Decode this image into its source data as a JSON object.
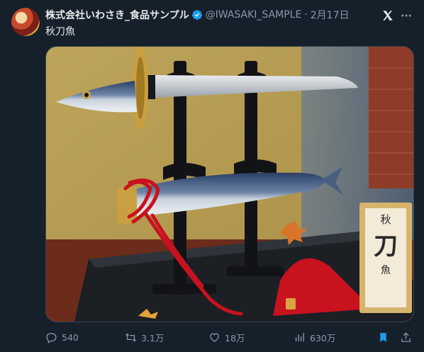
{
  "post": {
    "display_name": "株式会社いわさき_食品サンプル",
    "handle": "@IWASAKI_SAMPLE",
    "separator": "·",
    "date": "2月17日",
    "text": "秋刀魚",
    "verified": true,
    "avatar_icon": "company-logo-avatar",
    "media_label": "秋刀魚",
    "media_label_chars": [
      "秋",
      "刀",
      "魚"
    ]
  },
  "metrics": {
    "replies": "540",
    "reposts": "3.1万",
    "likes": "18万",
    "views": "630万"
  },
  "icons": {
    "reply": "reply-icon",
    "repost": "repost-icon",
    "like": "like-icon",
    "views": "views-icon",
    "bookmark": "bookmark-icon",
    "share": "share-icon",
    "grok": "grok-icon",
    "more": "more-icon"
  },
  "colors": {
    "background": "#15202b",
    "text": "#e7e9ea",
    "muted": "#8b98a5",
    "verified": "#1d9bf0",
    "bookmark_active": "#1d9bf0"
  }
}
